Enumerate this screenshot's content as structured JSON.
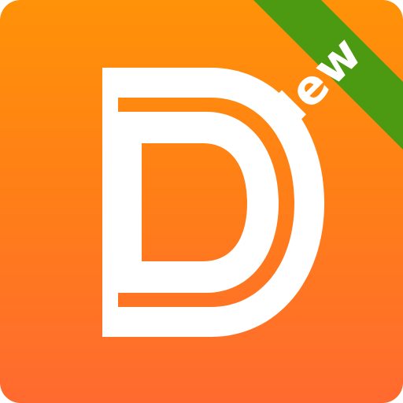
{
  "app_icon": {
    "letter_mark": "D",
    "badge_text": "New",
    "colors": {
      "gradient_top": "#ff9208",
      "gradient_bottom": "#ff6a30",
      "letter": "#ffffff",
      "ribbon": "#4c9a12"
    }
  }
}
